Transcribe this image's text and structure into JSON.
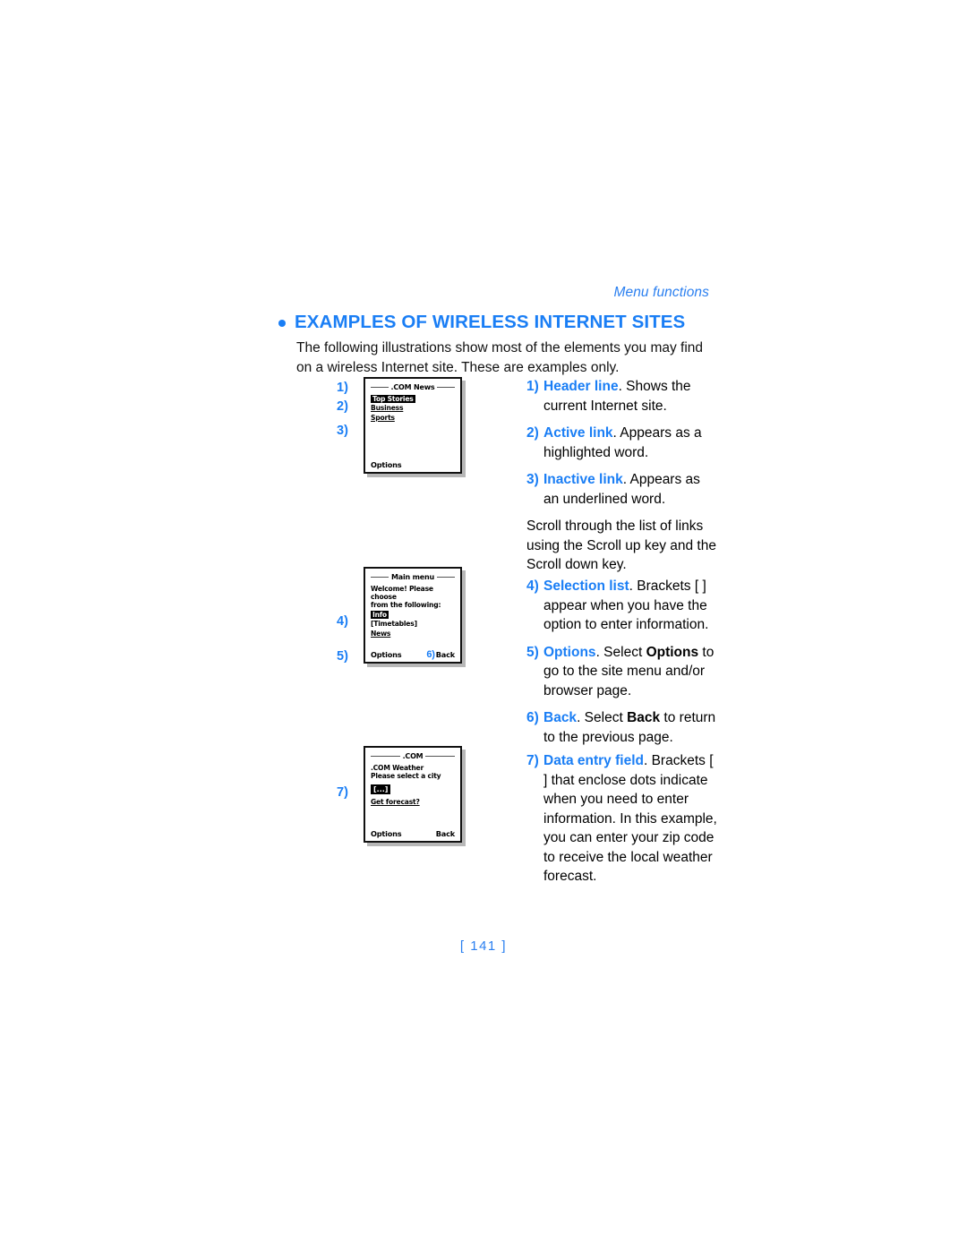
{
  "running_head": "Menu functions",
  "heading": "EXAMPLES OF WIRELESS INTERNET SITES",
  "intro": "The following illustrations show most of the elements you may find on a wireless Internet site. These are examples only.",
  "folio": "[ 141 ]",
  "colors": {
    "accent_blue": "#1a7ef5",
    "running_head_blue": "#2a7ff0",
    "body_text": "#111111"
  },
  "figures": [
    {
      "id": "news-screen",
      "markers": [
        "1)",
        "2)",
        "3)"
      ],
      "header": ".COM News",
      "items": [
        {
          "label": "Top Stories",
          "style": "active"
        },
        {
          "label": "Business",
          "style": "inactive"
        },
        {
          "label": "Sports",
          "style": "inactive"
        }
      ],
      "softkey_left": "Options",
      "softkey_right": "",
      "softkey_right_marker": ""
    },
    {
      "id": "main-menu-screen",
      "markers": [
        "4)",
        "5)"
      ],
      "header": "Main menu",
      "intro_line1": "Welcome! Please choose",
      "intro_line2": "from the following:",
      "items": [
        {
          "label": "Info",
          "style": "active"
        },
        {
          "label": "[Timetables]",
          "style": "plain"
        },
        {
          "label": "News",
          "style": "inactive"
        }
      ],
      "softkey_left": "Options",
      "softkey_right": "Back",
      "softkey_right_marker": "6)"
    },
    {
      "id": "weather-screen",
      "markers": [
        "7)"
      ],
      "header": ".COM",
      "intro_line1": ".COM Weather",
      "intro_line2": "Please select a city",
      "entry_field": "[...]",
      "items": [
        {
          "label": "Get forecast?",
          "style": "inactive"
        }
      ],
      "softkey_left": "Options",
      "softkey_right": "Back",
      "softkey_right_marker": ""
    }
  ],
  "notes": {
    "group1": [
      {
        "num": "1)",
        "term": "Header line",
        "rest": ". Shows the current Internet site."
      },
      {
        "num": "2)",
        "term": "Active link",
        "rest": ". Appears as a highlighted word."
      },
      {
        "num": "3)",
        "term": "Inactive link",
        "rest": ". Appears as an underlined word."
      }
    ],
    "scroll_paragraph": {
      "part1": "Scroll through the list of links using the ",
      "bold1": "Scroll up",
      "part2": " key and the ",
      "bold2": "Scroll down",
      "part3": " key."
    },
    "group2": [
      {
        "num": "4)",
        "term": "Selection list",
        "rest": ". Brackets [ ] appear when you have the option to enter information."
      },
      {
        "num": "5)",
        "term": "Options",
        "rest_pre": ". Select ",
        "bold": "Options",
        "rest_post": " to go to the site menu and/or browser page."
      },
      {
        "num": "6)",
        "term": "Back",
        "rest_pre": ". Select ",
        "bold": "Back",
        "rest_post": " to return to the previous page."
      }
    ],
    "group3": [
      {
        "num": "7)",
        "term": "Data entry field",
        "rest": ". Brackets [ ] that enclose dots indicate when you need to enter information. In this example, you can enter your zip code to receive the local weather forecast."
      }
    ]
  }
}
